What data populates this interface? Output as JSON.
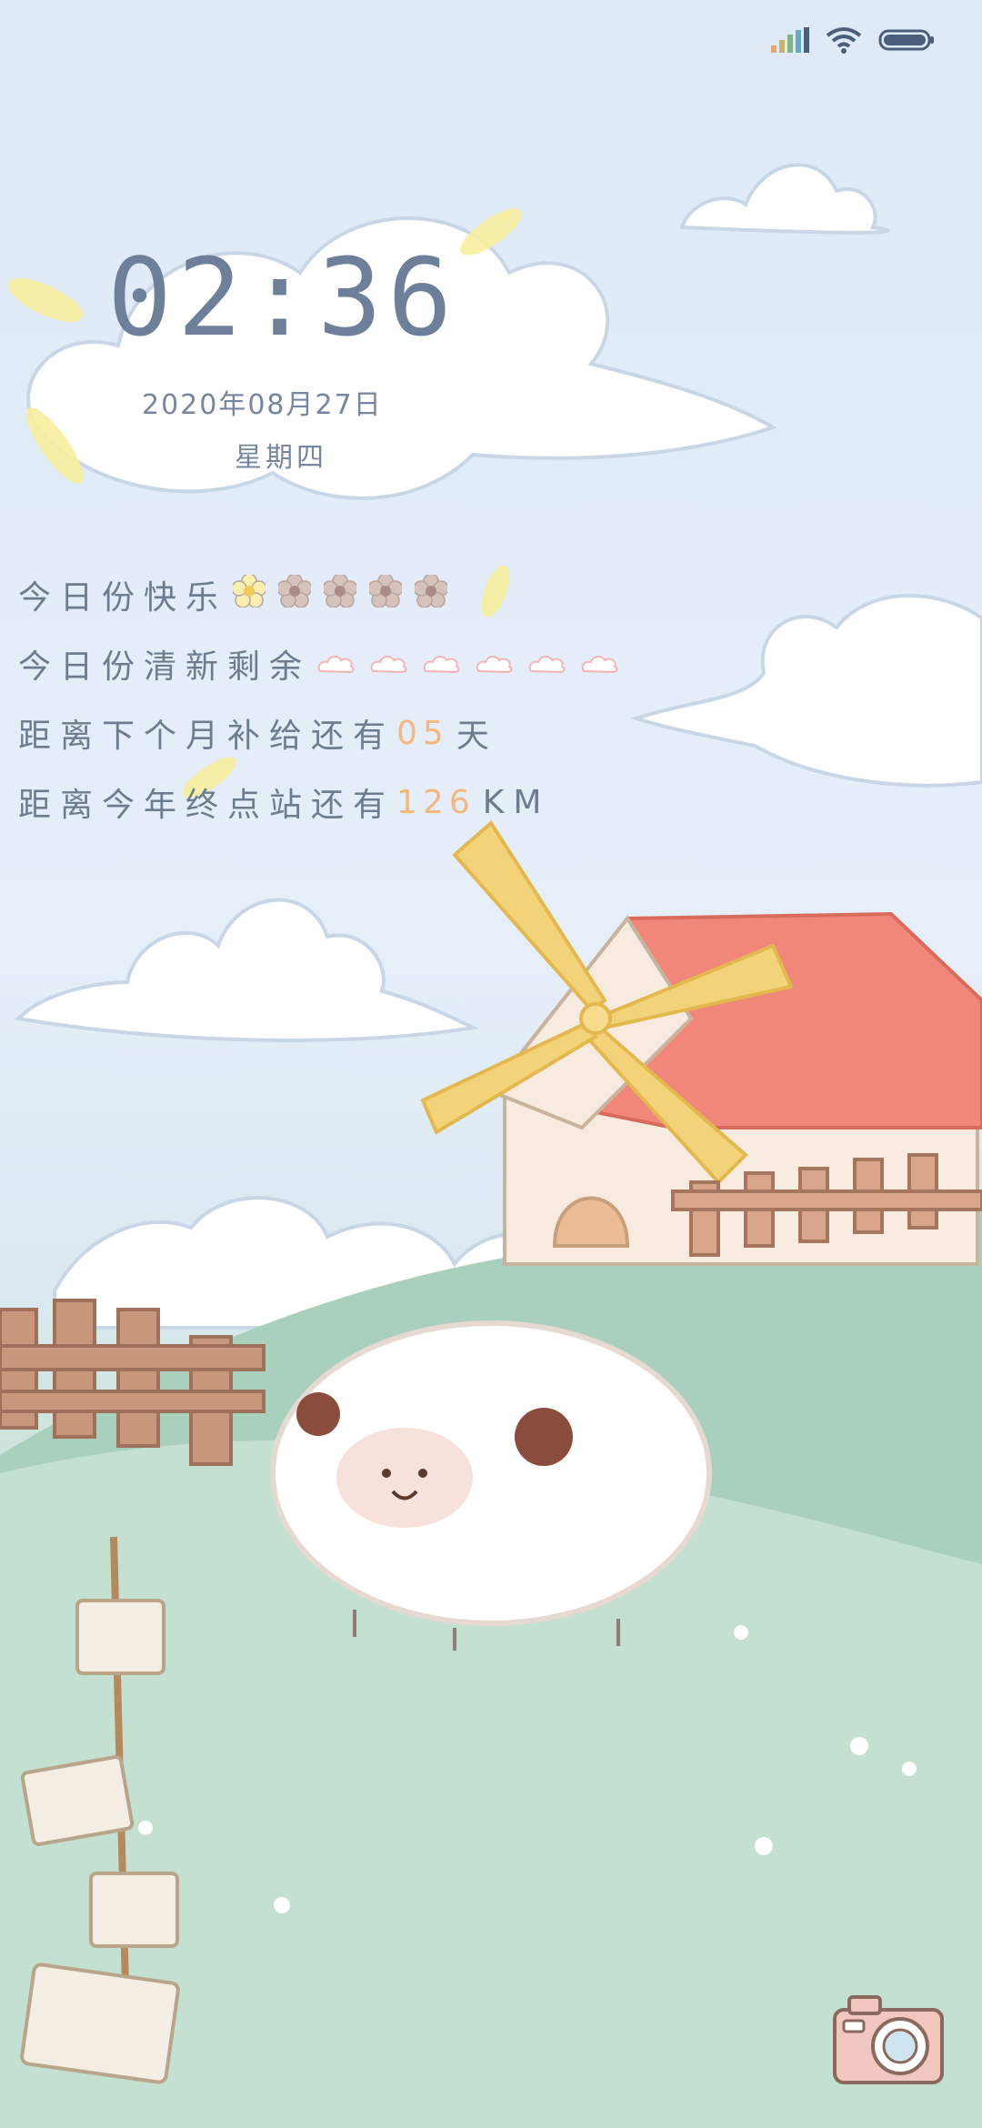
{
  "status": {
    "signal_icon": "signal-bars-icon",
    "wifi_icon": "wifi-icon",
    "battery_icon": "battery-icon"
  },
  "clock": {
    "time": "02:36",
    "date": "2020年08月27日",
    "weekday": "星期四"
  },
  "rows": {
    "happy_label": "今日份快乐",
    "happy_total": 5,
    "happy_filled": 1,
    "fresh_label": "今日份清新剩余",
    "fresh_count": 6,
    "supply_prefix": "距离下个月补给还有",
    "supply_days": "05",
    "supply_unit": "天",
    "terminal_prefix": "距离今年终点站还有",
    "terminal_km": "126",
    "terminal_unit": "KM"
  },
  "camera": {
    "icon": "camera-icon"
  },
  "colors": {
    "text": "#6e7c90",
    "accent": "#f5b77e",
    "roof": "#f0877a",
    "windmill": "#f2d37a",
    "grass": "#bcdcca"
  }
}
